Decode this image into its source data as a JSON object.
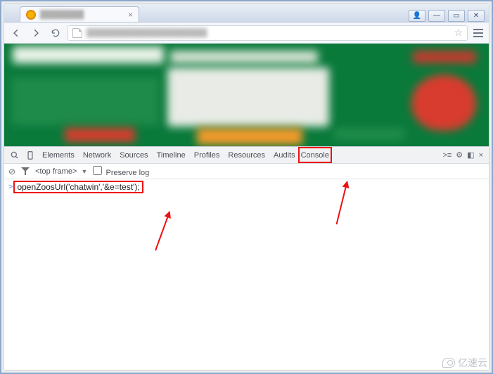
{
  "window": {
    "controls": {
      "user": "👤",
      "min": "—",
      "max": "▭",
      "close": "✕"
    },
    "tab": {
      "title": "████████",
      "close": "×"
    }
  },
  "toolbar": {
    "url": "██████████████████████"
  },
  "devtools": {
    "tabs": [
      "Elements",
      "Network",
      "Sources",
      "Timeline",
      "Profiles",
      "Resources",
      "Audits",
      "Console"
    ],
    "active_tab": "Console",
    "right_icons": {
      "drawer": ">≡",
      "settings": "⚙",
      "dock": "◧",
      "close": "×"
    }
  },
  "console_filter": {
    "frame": "<top frame>",
    "dropdown": "▼",
    "preserve_label": "Preserve log"
  },
  "console": {
    "prompt": ">",
    "code": "openZoosUrl('chatwin','&e=test');"
  },
  "watermark": "亿速云"
}
